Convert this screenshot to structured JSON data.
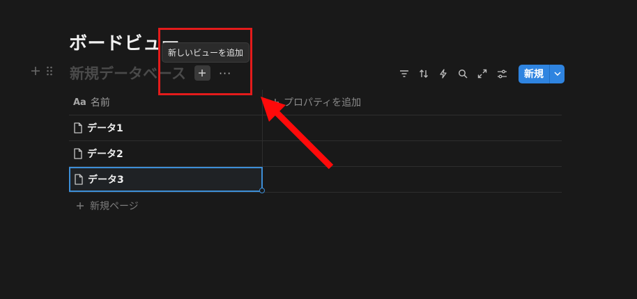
{
  "page": {
    "title": "ボードビュー"
  },
  "database": {
    "title": "新規データベース",
    "add_view_tooltip": "新しいビューを追加",
    "more_label": "···"
  },
  "toolbar": {
    "icons": [
      "filter-icon",
      "sort-icon",
      "automation-icon",
      "search-icon",
      "expand-icon",
      "settings-icon"
    ],
    "new_label": "新規"
  },
  "table": {
    "name_column": "名前",
    "name_column_type": "Aa",
    "add_property_label": "プロパティを追加",
    "rows": [
      {
        "name": "データ1"
      },
      {
        "name": "データ2"
      },
      {
        "name": "データ3"
      }
    ],
    "new_page_label": "新規ページ"
  },
  "colors": {
    "accent": "#2f84e0",
    "highlight": "#e41b1b",
    "background": "#191919"
  }
}
